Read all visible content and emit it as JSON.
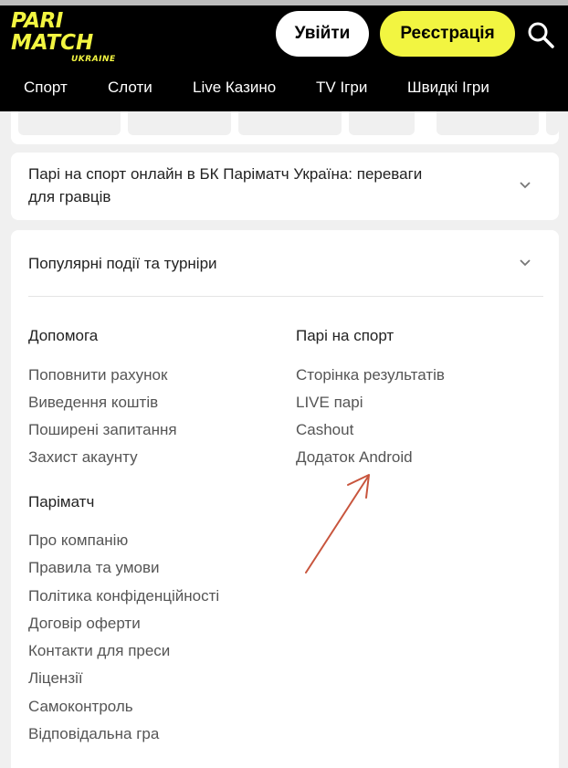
{
  "header": {
    "logo": {
      "line1": "PARI",
      "line2": "MATCH",
      "sub": "UKRAINE"
    },
    "login_label": "Увійти",
    "register_label": "Реєстрація",
    "search_icon": "search-icon"
  },
  "nav": {
    "items": [
      {
        "label": "Спорт"
      },
      {
        "label": "Слоти"
      },
      {
        "label": "Live Казино"
      },
      {
        "label": "TV Ігри"
      },
      {
        "label": "Швидкі Ігри"
      }
    ]
  },
  "accordion1": {
    "line1": "Парі на спорт онлайн в БК Паріматч Україна: переваги",
    "line2": "для гравців"
  },
  "accordion2": {
    "title": "Популярні події та турніри"
  },
  "footer": {
    "col_help": {
      "title": "Допомога",
      "links": [
        "Поповнити рахунок",
        "Виведення коштів",
        "Поширені запитання",
        "Захист акаунту"
      ]
    },
    "col_sport": {
      "title": "Парі на спорт",
      "links": [
        "Сторінка результатів",
        "LIVE парі",
        "Cashout",
        "Додаток Android"
      ]
    },
    "col_company": {
      "title": "Паріматч",
      "links": [
        "Про компанію",
        "Правила та умови",
        "Політика конфіденційності",
        "Договір оферти",
        "Контакти для преси",
        "Ліцензії",
        "Самоконтроль",
        "Відповідальна гра"
      ]
    }
  },
  "colors": {
    "brand_yellow": "#f2f541",
    "header_bg": "#000000",
    "annotation_arrow": "#c8553d"
  }
}
